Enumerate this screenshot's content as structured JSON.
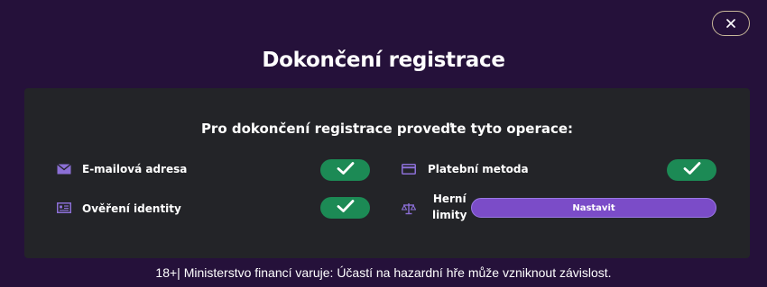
{
  "dialog": {
    "title": "Dokončení registrace",
    "close_icon": "close-icon",
    "subtitle": "Pro dokončení registrace proveďte tyto operace:"
  },
  "steps": {
    "email": {
      "label": "E-mailová adresa",
      "icon": "envelope-icon",
      "status": "completed"
    },
    "identity": {
      "label": "Ověření identity",
      "icon": "id-card-icon",
      "status": "completed"
    },
    "payment": {
      "label": "Platební metoda",
      "icon": "credit-card-icon",
      "status": "completed"
    },
    "limits": {
      "label_line1": "Herní",
      "label_line2": "limity",
      "icon": "scale-icon",
      "button_label": "Nastavit",
      "status": "pending"
    }
  },
  "footer": {
    "warning": "18+| Ministerstvo financí varuje: Účastí na hazardní hře může vzniknout závislost."
  },
  "colors": {
    "background": "#25113a",
    "panel": "#232428",
    "success": "#1c8a55",
    "accent": "#7b4cc8",
    "icon": "#8b6fd6",
    "close_border": "#c9b99a"
  }
}
